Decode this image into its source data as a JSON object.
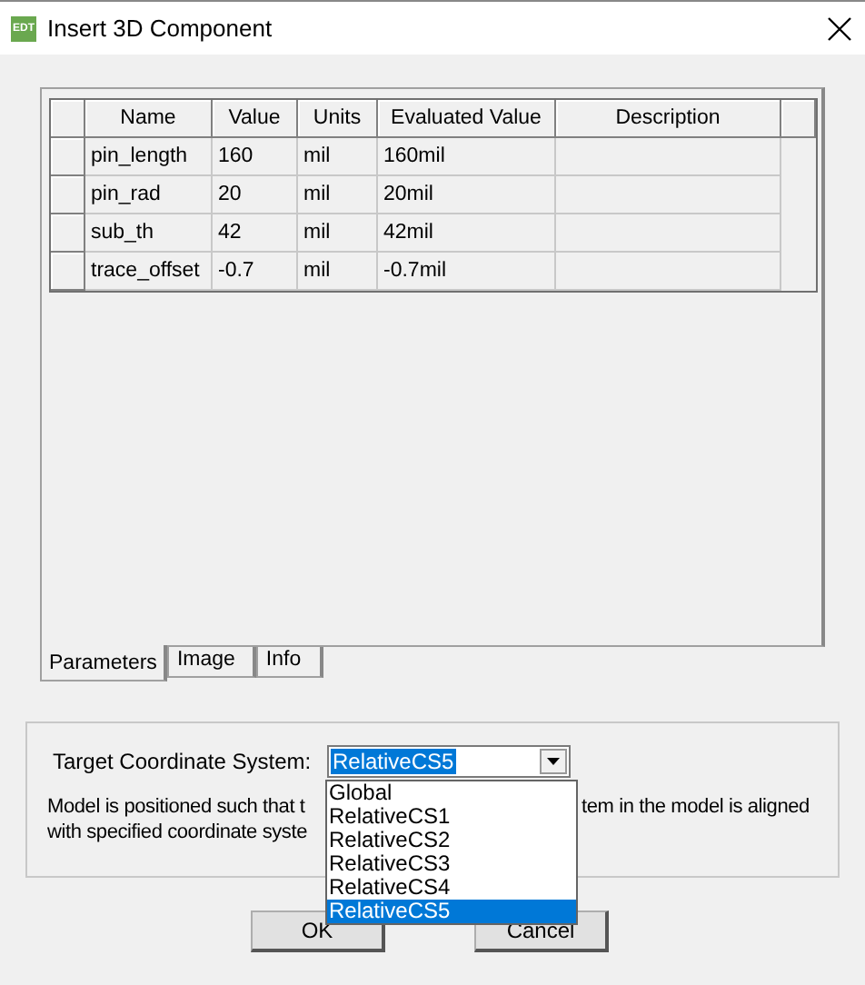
{
  "window": {
    "title": "Insert 3D Component",
    "app_icon": "EDT"
  },
  "table": {
    "columns": [
      "Name",
      "Value",
      "Units",
      "Evaluated Value",
      "Description"
    ],
    "rows": [
      {
        "cells": [
          "pin_length",
          "160",
          "mil",
          "160mil",
          ""
        ]
      },
      {
        "cells": [
          "pin_rad",
          "20",
          "mil",
          "20mil",
          ""
        ]
      },
      {
        "cells": [
          "sub_th",
          "42",
          "mil",
          "42mil",
          ""
        ]
      },
      {
        "cells": [
          "trace_offset",
          "-0.7",
          "mil",
          "-0.7mil",
          ""
        ]
      }
    ]
  },
  "tabs": [
    {
      "label": "Parameters",
      "selected": true
    },
    {
      "label": "Image",
      "selected": false
    },
    {
      "label": "Info",
      "selected": false
    }
  ],
  "target": {
    "label": "Target Coordinate System:",
    "value": "RelativeCS5",
    "options": [
      {
        "label": "Global",
        "selected": false
      },
      {
        "label": "RelativeCS1",
        "selected": false
      },
      {
        "label": "RelativeCS2",
        "selected": false
      },
      {
        "label": "RelativeCS3",
        "selected": false
      },
      {
        "label": "RelativeCS4",
        "selected": false
      },
      {
        "label": "RelativeCS5",
        "selected": true
      }
    ],
    "description_parts": [
      "Model is positioned such that t",
      "tem in the model is aligned",
      "with specified coordinate syste"
    ]
  },
  "buttons": [
    "OK",
    "Cancel"
  ]
}
